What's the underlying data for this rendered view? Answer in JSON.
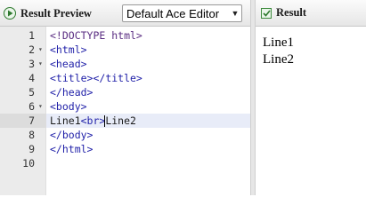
{
  "left_toolbar": {
    "preview_label": "Result Preview",
    "editor_select_value": "Default Ace Editor"
  },
  "right_toolbar": {
    "result_label": "Result"
  },
  "editor": {
    "active_line": 7,
    "lines": [
      {
        "num": "1",
        "fold": "",
        "text": "<!DOCTYPE html>"
      },
      {
        "num": "2",
        "fold": "▾",
        "text": "<html>"
      },
      {
        "num": "3",
        "fold": "▾",
        "text": "<head>"
      },
      {
        "num": "4",
        "fold": "",
        "text": "<title></title>"
      },
      {
        "num": "5",
        "fold": "",
        "text": "</head>"
      },
      {
        "num": "6",
        "fold": "▾",
        "text": "<body>"
      },
      {
        "num": "7",
        "fold": "",
        "text_before_cursor": "Line1<br>",
        "text_after_cursor": "Line2"
      },
      {
        "num": "8",
        "fold": "",
        "text": "</body>"
      },
      {
        "num": "9",
        "fold": "",
        "text": "</html>"
      },
      {
        "num": "10",
        "fold": "",
        "text": ""
      }
    ]
  },
  "result": {
    "lines": [
      "Line1",
      "Line2"
    ]
  },
  "colors": {
    "tag": "#1f1fa8",
    "active_line_bg": "#e8ecf8",
    "gutter_bg": "#ebebeb"
  }
}
